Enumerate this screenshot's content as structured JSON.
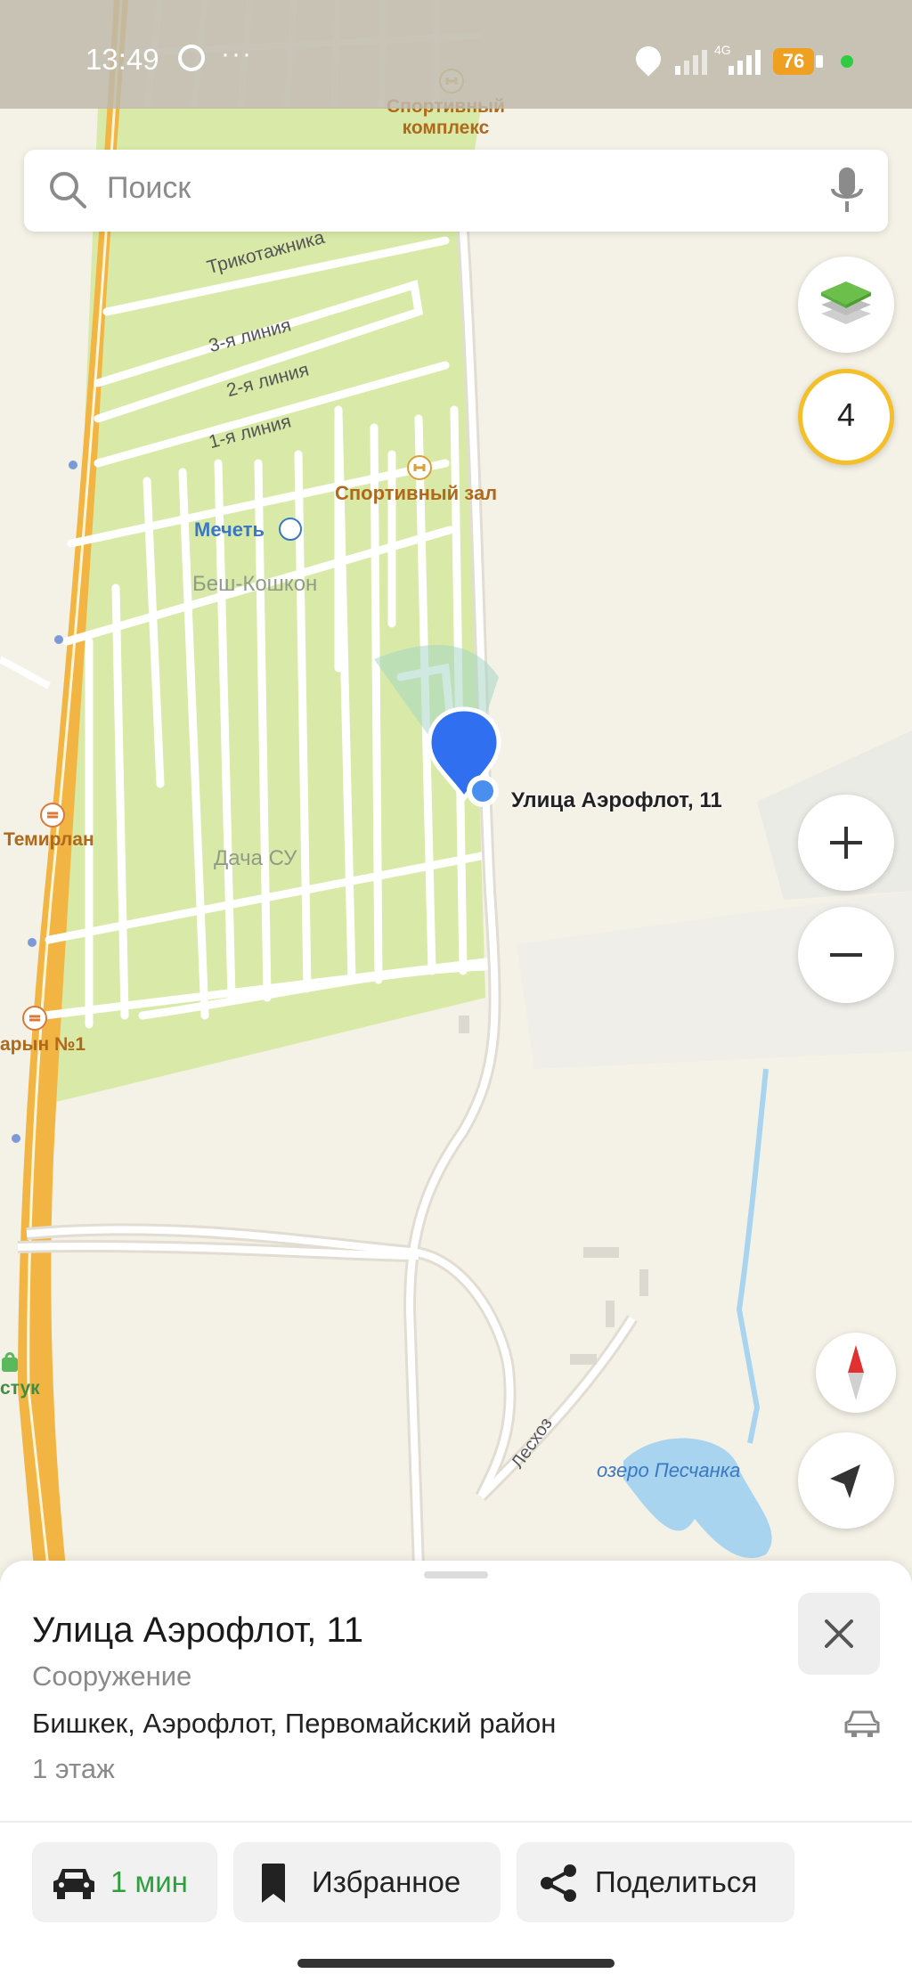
{
  "status_bar": {
    "time": "13:49",
    "more": "···",
    "network": "4G",
    "battery": "76"
  },
  "search": {
    "placeholder": "Поиск"
  },
  "map_controls": {
    "traffic_level": "4",
    "zoom_in": "+",
    "zoom_out": "−"
  },
  "map_labels": {
    "sports_complex": [
      "Спортивный",
      "комплекс"
    ],
    "street_1": "Трикотажника",
    "street_2": "3-я линия",
    "street_3": "2-я линия",
    "street_4": "1-я линия",
    "gym": "Спортивный зал",
    "mosque": "Мечеть",
    "district": "Беш-Кошкон",
    "temirlan": "Темирлан",
    "dacha": "Дача СУ",
    "selected_pin": "Улица Аэрофлот, 11",
    "rest_place": "арын №1",
    "shop": "стук",
    "leskhoz": "Лесхоз",
    "lake": "озеро Песчанка"
  },
  "place_card": {
    "title": "Улица Аэрофлот, 11",
    "category": "Сооружение",
    "address": "Бишкек, Аэрофлот, Первомайский район",
    "floors": "1 этаж",
    "route_time": "1 мин",
    "favorite_label": "Избранное",
    "share_label": "Поделиться"
  },
  "colors": {
    "park_green": "#d9eaa8",
    "highway": "#f2b544",
    "water": "#a9d4f0",
    "pin_blue": "#2f6ff0",
    "route_green": "#2e9e3e"
  }
}
